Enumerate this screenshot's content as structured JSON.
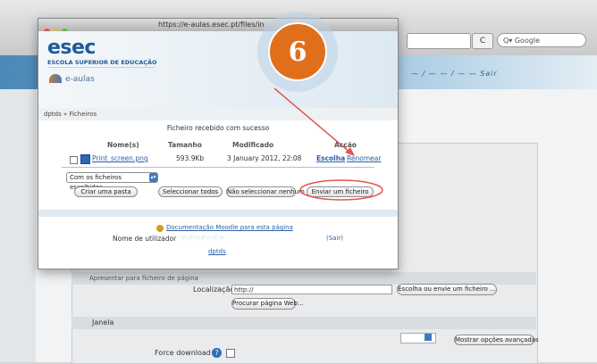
{
  "browser": {
    "search_placeholder": "Q▾ Google",
    "refresh_glyph": "C",
    "banner_text": "— / — — / — — Sair"
  },
  "background_form": {
    "appearance_header": "Apresentar para ficheiro de página",
    "localizacao_label": "Localização",
    "localizacao_value": "http://",
    "escolha_button": "Escolha ou envie um ficheiro ...",
    "procurar_button": "Procurar página Web...",
    "janela_label": "Janela",
    "mostrar_button": "Mostrar opções avançadas",
    "force_download_label": "Force download"
  },
  "popup": {
    "url": "https://e-aulas.esec.pt/files/in",
    "logo_title": "esec",
    "logo_subtitle": "ESCOLA SUPERIOR DE EDUCAÇÃO",
    "logo_eaulas": "e-aulas",
    "breadcrumb": "dptds » Ficheiros",
    "message": "Ficheiro recebido com sucesso",
    "table": {
      "headers": [
        "Nome(s)",
        "Tamanho",
        "Modificado",
        "Acção"
      ],
      "rows": [
        {
          "name": "Print_screen.png",
          "size": "593.9Kb",
          "modified": "3 January 2012, 22:08",
          "action_choose": "Escolha",
          "action_rename": "Renomear"
        }
      ]
    },
    "select_value": "Com os ficheiros escolhidos...",
    "buttons": {
      "create_folder": "Criar uma pasta",
      "select_all": "Seleccionar todos",
      "select_none": "Não seleccionar nenhum",
      "upload": "Enviar um ficheiro"
    },
    "doc_link": "Documentação Moodle para esta página",
    "user_label": "Nome de utilizador",
    "user_name": "— / — / — / —",
    "sair_link": "(Sair)",
    "footer_link": "dptds"
  },
  "annotation": {
    "step_number": "6",
    "badge_color": "#e06f1c",
    "arrow_color": "#e0584f"
  }
}
